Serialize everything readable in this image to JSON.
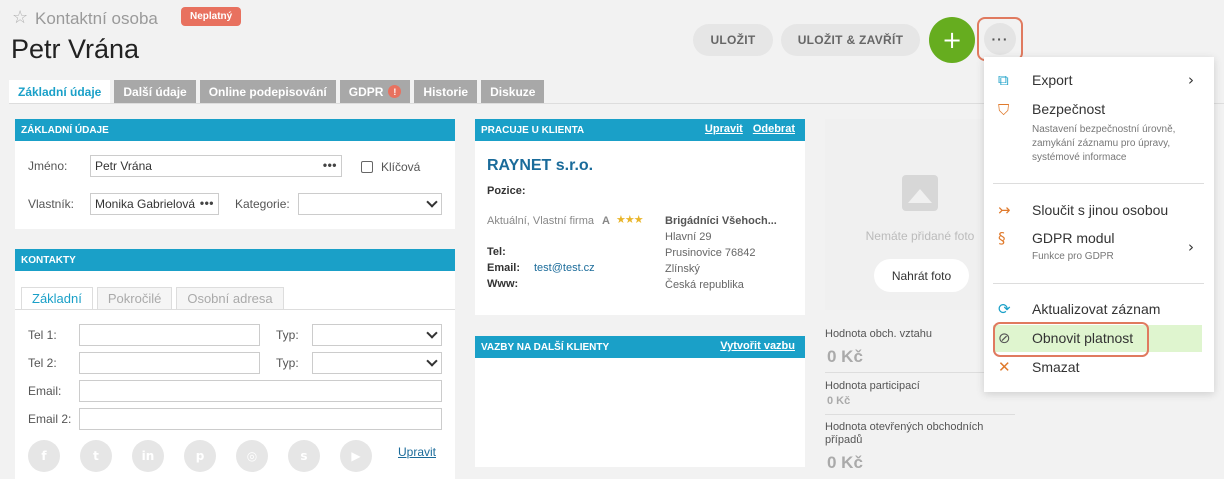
{
  "header": {
    "record_type": "Kontaktní osoba",
    "status_badge": "Neplatný",
    "title": "Petr Vrána",
    "save_label": "ULOŽIT",
    "save_close_label": "ULOŽIT & ZAVŘÍT",
    "add_label": "+",
    "more_label": "···"
  },
  "tabs": [
    {
      "label": "Základní údaje",
      "active": true
    },
    {
      "label": "Další údaje"
    },
    {
      "label": "Online podepisování"
    },
    {
      "label": "GDPR",
      "badge": "!"
    },
    {
      "label": "Historie"
    },
    {
      "label": "Diskuze"
    }
  ],
  "basic": {
    "title": "ZÁKLADNÍ ÚDAJE",
    "name_label": "Jméno:",
    "name_value": "Petr Vrána",
    "key_label": "Klíčová",
    "owner_label": "Vlastník:",
    "owner_value": "Monika Gabrielová",
    "category_label": "Kategorie:",
    "category_value": ""
  },
  "contacts": {
    "title": "KONTAKTY",
    "subtabs": [
      "Základní",
      "Pokročilé",
      "Osobní adresa"
    ],
    "tel1_label": "Tel 1:",
    "tel2_label": "Tel 2:",
    "type_label": "Typ:",
    "email_label": "Email:",
    "email2_label": "Email 2:",
    "edit_label": "Upravit"
  },
  "client": {
    "title": "PRACUJE U KLIENTA",
    "edit_label": "Upravit",
    "remove_label": "Odebrat",
    "name": "RAYNET s.r.o.",
    "position_label": "Pozice:",
    "relation": "Aktuální, Vlastní firma",
    "rating": "A",
    "stars": "★★★",
    "company": "Brigádníci Všehoch...",
    "street": "Hlavní 29",
    "city": "Prusinovice 76842",
    "region": "Zlínský",
    "country": "Česká republika",
    "tel_label": "Tel:",
    "email_label": "Email:",
    "email_value": "test@test.cz",
    "www_label": "Www:"
  },
  "links": {
    "title": "VAZBY NA DALŠÍ KLIENTY",
    "create_label": "Vytvořit vazbu"
  },
  "photo": {
    "none_text": "Nemáte přidané foto",
    "upload_label": "Nahrát foto"
  },
  "stats": [
    {
      "label": "Hodnota obch. vztahu",
      "value": "0 Kč"
    },
    {
      "label": "Hodnota participací",
      "value": "0 Kč"
    },
    {
      "label": "Hodnota otevřených obchodních případů",
      "value": "0 Kč"
    }
  ],
  "menu": {
    "export": "Export",
    "security": "Bezpečnost",
    "security_desc": "Nastavení bezpečnostní úrovně, zamykání záznamu pro úpravy, systémové informace",
    "merge": "Sloučit s jinou osobou",
    "gdpr": "GDPR modul",
    "gdpr_desc": "Funkce pro GDPR",
    "refresh": "Aktualizovat záznam",
    "restore": "Obnovit platnost",
    "delete": "Smazat"
  },
  "colors": {
    "accent": "#1aa0c8",
    "add_button": "#66ad1f",
    "badge_invalid": "#e8715f",
    "menu_icon_orange": "#e07a2c",
    "menu_highlight": "#dff5cf"
  }
}
